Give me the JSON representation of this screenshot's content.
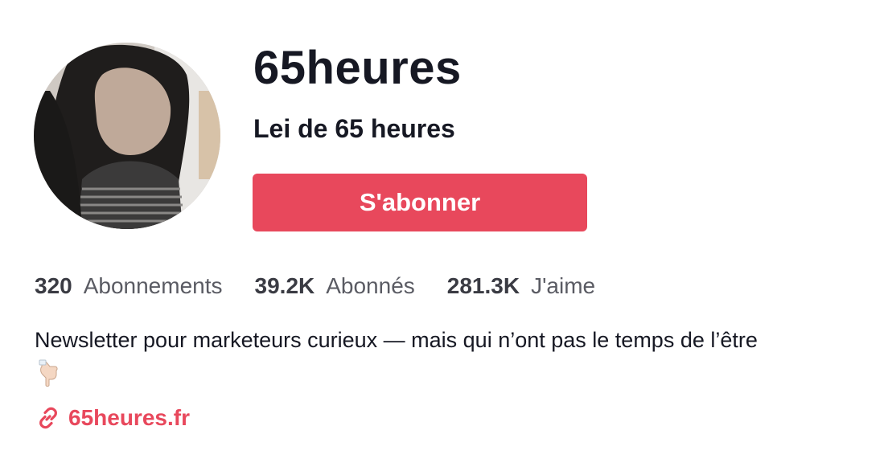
{
  "profile": {
    "username": "65heures",
    "nickname": "Lei de 65 heures",
    "follow_label": "S'abonner",
    "avatar_icon": "profile-photo"
  },
  "stats": [
    {
      "value": "320",
      "label": "Abonnements"
    },
    {
      "value": "39.2K",
      "label": "Abonnés"
    },
    {
      "value": "281.3K",
      "label": "J'aime"
    }
  ],
  "bio": {
    "text": "Newsletter pour marketeurs curieux — mais qui n’ont pas le temps de l’être",
    "emoji_icon": "pointing-down-hand-icon"
  },
  "link": {
    "icon": "link-icon",
    "text": "65heures.fr"
  },
  "colors": {
    "accent": "#e8485c",
    "text": "#161823",
    "muted": "#5a5b63"
  }
}
